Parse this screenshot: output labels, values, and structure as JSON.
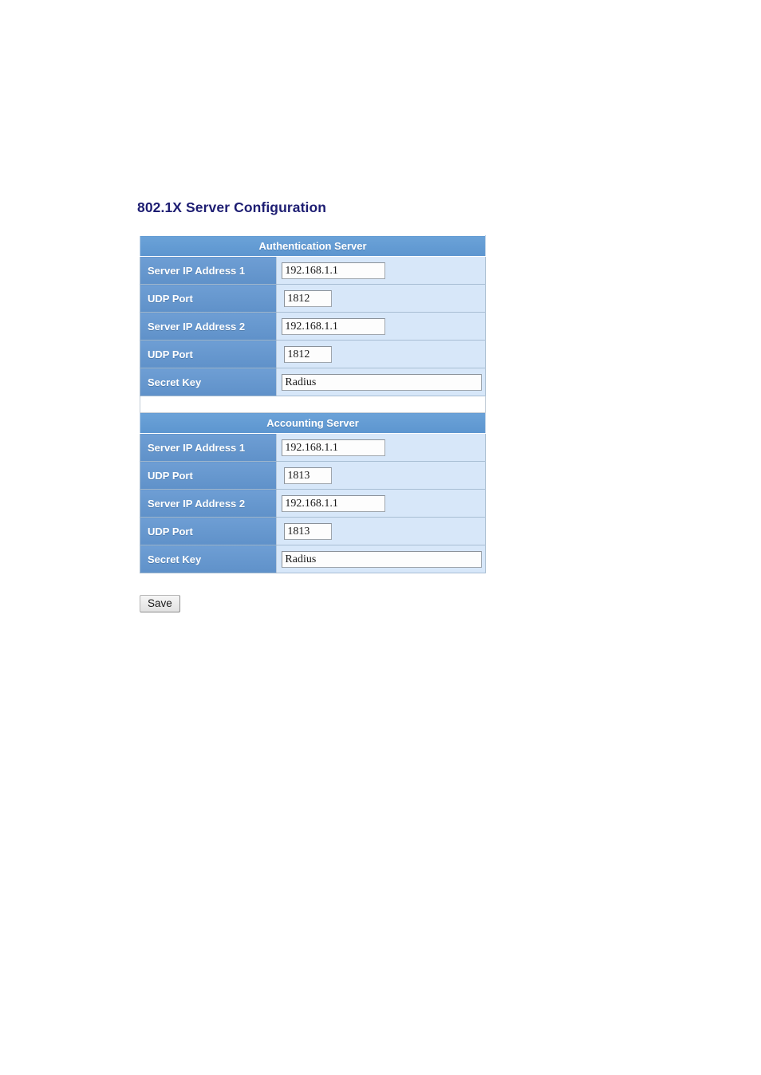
{
  "page": {
    "title": "802.1X Server Configuration",
    "title_color": "#1d1d72",
    "background": "#ffffff"
  },
  "theme": {
    "header_bg": "#619bd4",
    "label_bg": "#6596cd",
    "value_bg": "#d7e7f9",
    "label_text": "#ffffff",
    "table_border": "#9aa3ad"
  },
  "sections": [
    {
      "header": "Authentication Server",
      "rows": [
        {
          "label": "Server IP Address 1",
          "value": "192.168.1.1",
          "field": "ip",
          "name": "auth-server-ip-1"
        },
        {
          "label": "UDP Port",
          "value": "1812",
          "field": "port",
          "name": "auth-udp-port-1"
        },
        {
          "label": "Server IP Address 2",
          "value": "192.168.1.1",
          "field": "ip",
          "name": "auth-server-ip-2"
        },
        {
          "label": "UDP Port",
          "value": "1812",
          "field": "port",
          "name": "auth-udp-port-2"
        },
        {
          "label": "Secret Key",
          "value": "Radius",
          "field": "key",
          "name": "auth-secret-key"
        }
      ]
    },
    {
      "header": "Accounting Server",
      "rows": [
        {
          "label": "Server IP Address 1",
          "value": "192.168.1.1",
          "field": "ip",
          "name": "acct-server-ip-1"
        },
        {
          "label": "UDP Port",
          "value": "1813",
          "field": "port",
          "name": "acct-udp-port-1"
        },
        {
          "label": "Server IP Address 2",
          "value": "192.168.1.1",
          "field": "ip",
          "name": "acct-server-ip-2"
        },
        {
          "label": "UDP Port",
          "value": "1813",
          "field": "port",
          "name": "acct-udp-port-2"
        },
        {
          "label": "Secret Key",
          "value": "Radius",
          "field": "key",
          "name": "acct-secret-key"
        }
      ]
    }
  ],
  "actions": {
    "save_label": "Save"
  }
}
